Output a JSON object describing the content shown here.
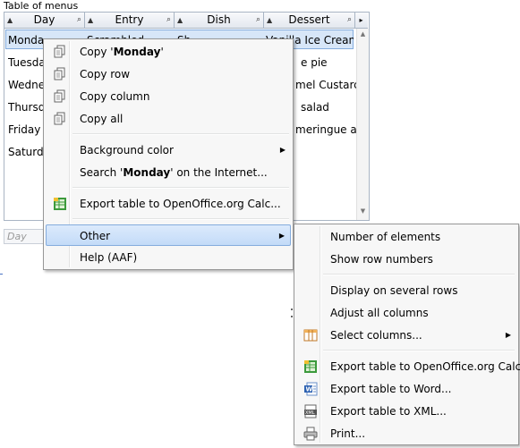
{
  "caption": "Table of menus",
  "table": {
    "columns": [
      "Day",
      "Entry",
      "Dish",
      "Dessert"
    ],
    "rows": [
      {
        "day": "Monday",
        "entry": "Scrambled",
        "dish": "Sh",
        "dessert": "Vanilla Ice Cream"
      },
      {
        "day": "Tuesday",
        "dessert": "Apple pie"
      },
      {
        "day": "Wednesday",
        "dessert": "Caramel Custard"
      },
      {
        "day": "Thursday",
        "dessert": "Fruit salad"
      },
      {
        "day": "Friday",
        "dessert": "Lemon meringue and"
      },
      {
        "day": "Saturday",
        "dessert": ""
      }
    ],
    "visible_text": {
      "row1_day": "Monda",
      "row1_entry": "Scrambled",
      "row1_dish": "Sh",
      "row1_dessert": "Vanilla Ice Crean",
      "row2_day": "Tuesda",
      "row2_dessert": "e pie",
      "row3_day": "Wedne",
      "row3_dessert": "mel Custarc",
      "row4_day": "Thursd",
      "row4_dessert": "salad",
      "row5_day": "Friday",
      "row5_dessert": "meringue ar",
      "row6_day": "Saturd"
    }
  },
  "filter": {
    "placeholder": "Day"
  },
  "context_menu": {
    "items": [
      {
        "pre": "Copy '",
        "bold": "Monday",
        "post": "'"
      },
      {
        "label": "Copy row"
      },
      {
        "label": "Copy column"
      },
      {
        "label": "Copy all"
      },
      {
        "label": "Background color"
      },
      {
        "pre": "Search '",
        "bold": "Monday",
        "post": "' on the Internet..."
      },
      {
        "label": "Export table to OpenOffice.org Calc..."
      },
      {
        "label": "Other"
      },
      {
        "label": "Help (AAF)"
      }
    ]
  },
  "submenu": {
    "items": [
      {
        "label": "Number of elements"
      },
      {
        "label": "Show row numbers"
      },
      {
        "label": "Display on several rows"
      },
      {
        "label": "Adjust all columns"
      },
      {
        "label": "Select columns..."
      },
      {
        "label": "Export table to OpenOffice.org Calc..."
      },
      {
        "label": "Export table to Word..."
      },
      {
        "label": "Export table to XML..."
      },
      {
        "label": "Print..."
      }
    ]
  },
  "colors": {
    "highlight": "#c3dbf8",
    "selection": "#d7e6f8",
    "calc_green": "#2e8b2e",
    "word_blue": "#2a5fb0"
  }
}
